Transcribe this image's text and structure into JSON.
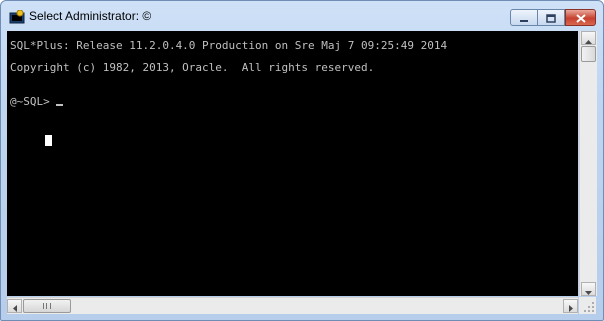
{
  "window": {
    "title": "Select Administrator: ©",
    "controls": {
      "minimize": "minimize",
      "maximize": "maximize",
      "close": "close"
    }
  },
  "console": {
    "lines": [
      "SQL*Plus: Release 11.2.0.4.0 Production on Sre Maj 7 09:25:49 2014",
      "Copyright (c) 1982, 2013, Oracle.  All rights reserved.",
      "@~SQL>"
    ],
    "text_color": "#c0c0c0",
    "background": "#000000"
  },
  "icons": {
    "app": "console-app-icon",
    "minimize": "minimize-icon",
    "maximize": "maximize-icon",
    "close": "close-icon",
    "scroll_up": "arrow-up-icon",
    "scroll_down": "arrow-down-icon",
    "scroll_left": "arrow-left-icon",
    "scroll_right": "arrow-right-icon"
  }
}
